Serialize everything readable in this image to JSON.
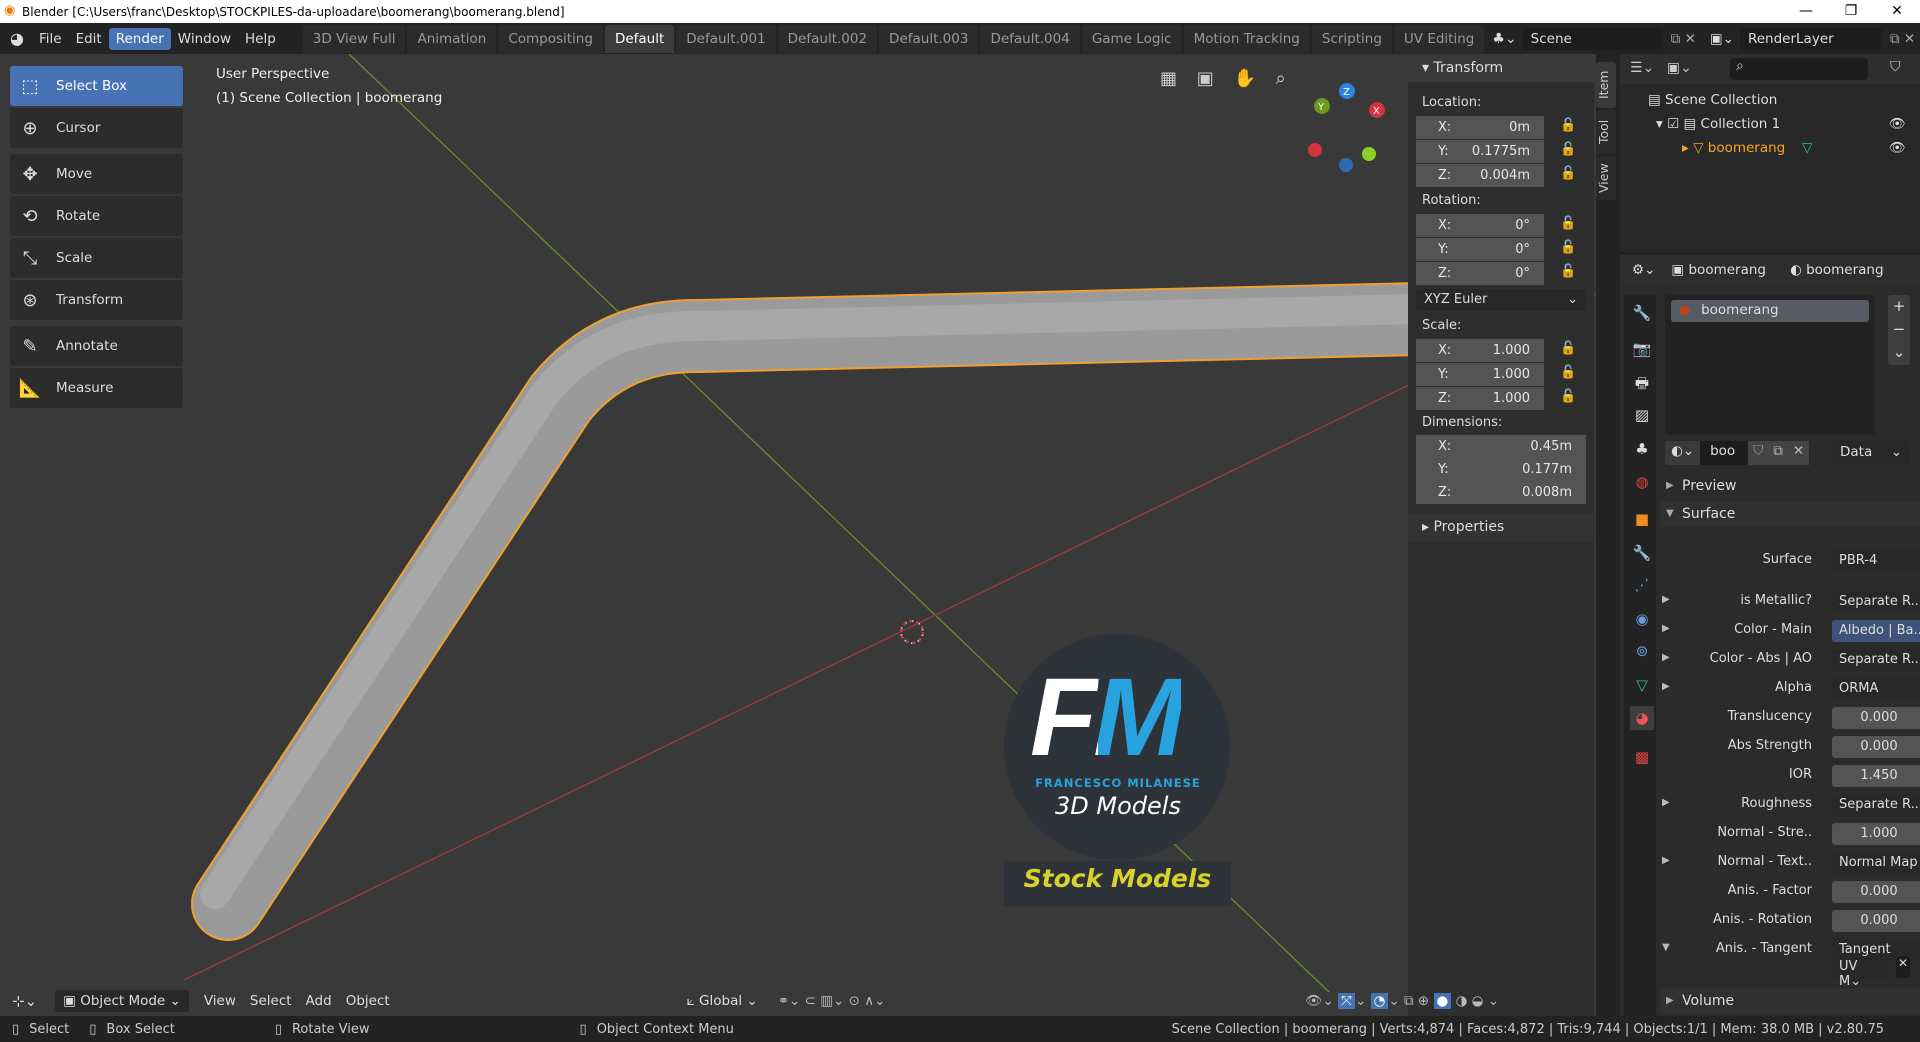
{
  "window": {
    "title": "Blender [C:\\Users\\franc\\Desktop\\STOCKPILES-da-uploadare\\boomerang\\boomerang.blend]",
    "minimize": "—",
    "maximize": "❐",
    "close": "✕"
  },
  "menu": [
    "File",
    "Edit",
    "Render",
    "Window",
    "Help"
  ],
  "workspaces": [
    "3D View Full",
    "Animation",
    "Compositing",
    "Default",
    "Default.001",
    "Default.002",
    "Default.003",
    "Default.004",
    "Game Logic",
    "Motion Tracking",
    "Scripting",
    "UV Editing"
  ],
  "scene": "Scene",
  "render_layer": "RenderLayer",
  "viewport": {
    "view_name": "User Perspective",
    "context": "(1) Scene Collection | boomerang"
  },
  "tools": [
    "Select Box",
    "Cursor",
    "Move",
    "Rotate",
    "Scale",
    "Transform",
    "Annotate",
    "Measure"
  ],
  "npanel": {
    "tabs": [
      "Item",
      "Tool",
      "View"
    ],
    "transform_title": "Transform",
    "location_label": "Location:",
    "location": {
      "x": "0m",
      "y": "0.1775m",
      "z": "0.004m"
    },
    "rotation_label": "Rotation:",
    "rotation": {
      "x": "0°",
      "y": "0°",
      "z": "0°"
    },
    "rotation_mode": "XYZ Euler",
    "scale_label": "Scale:",
    "scale": {
      "x": "1.000",
      "y": "1.000",
      "z": "1.000"
    },
    "dimensions_label": "Dimensions:",
    "dimensions": {
      "x": "0.45m",
      "y": "0.177m",
      "z": "0.008m"
    },
    "axis": {
      "x": "X:",
      "y": "Y:",
      "z": "Z:"
    },
    "properties": "Properties"
  },
  "outliner": {
    "scene_collection": "Scene Collection",
    "collection": "Collection 1",
    "object": "boomerang"
  },
  "properties": {
    "object": "boomerang",
    "material": "boomerang",
    "slot": "boomerang",
    "mat_name": "boo",
    "link": "Data",
    "preview": "Preview",
    "surface_section": "Surface",
    "volume": "Volume",
    "rows": [
      {
        "label": "Surface",
        "value": "PBR-4",
        "arrow": ""
      },
      {
        "label": "is Metallic?",
        "value": "Separate R..",
        "arrow": "▶"
      },
      {
        "label": "Color - Main",
        "value": "Albedo | Ba..",
        "arrow": "▶"
      },
      {
        "label": "Color - Abs | AO",
        "value": "Separate R..",
        "arrow": "▶"
      },
      {
        "label": "Alpha",
        "value": "ORMA",
        "arrow": "▶"
      },
      {
        "label": "Translucency",
        "value": "0.000",
        "arrow": ""
      },
      {
        "label": "Abs Strength",
        "value": "0.000",
        "arrow": ""
      },
      {
        "label": "IOR",
        "value": "1.450",
        "arrow": ""
      },
      {
        "label": "Roughness",
        "value": "Separate R..",
        "arrow": "▶"
      },
      {
        "label": "Normal - Stre..",
        "value": "1.000",
        "arrow": ""
      },
      {
        "label": "Normal - Text..",
        "value": "Normal Map",
        "arrow": "▶"
      },
      {
        "label": "Anis. - Factor",
        "value": "0.000",
        "arrow": ""
      },
      {
        "label": "Anis. - Rotation",
        "value": "0.000",
        "arrow": ""
      },
      {
        "label": "Anis. - Tangent",
        "value": "Tangent",
        "arrow": "▼"
      }
    ],
    "uv_map": "UV M"
  },
  "viewport_header": {
    "mode": "Object Mode",
    "menus": [
      "View",
      "Select",
      "Add",
      "Object"
    ],
    "orientation": "Global"
  },
  "watermark": {
    "initials": "FM",
    "name": "FRANCESCO MILANESE",
    "sub": "3D Models",
    "banner": "Stock Models"
  },
  "status": {
    "select": "Select",
    "box_select": "Box Select",
    "rotate": "Rotate View",
    "context_menu": "Object Context Menu",
    "info": "Scene Collection | boomerang | Verts:4,874 | Faces:4,872 | Tris:9,744 | Objects:1/1 | Mem: 38.0 MB | v2.80.75"
  },
  "colors": {
    "accent": "#4772b3",
    "selection": "#f5a623",
    "viewport": "#393939"
  }
}
